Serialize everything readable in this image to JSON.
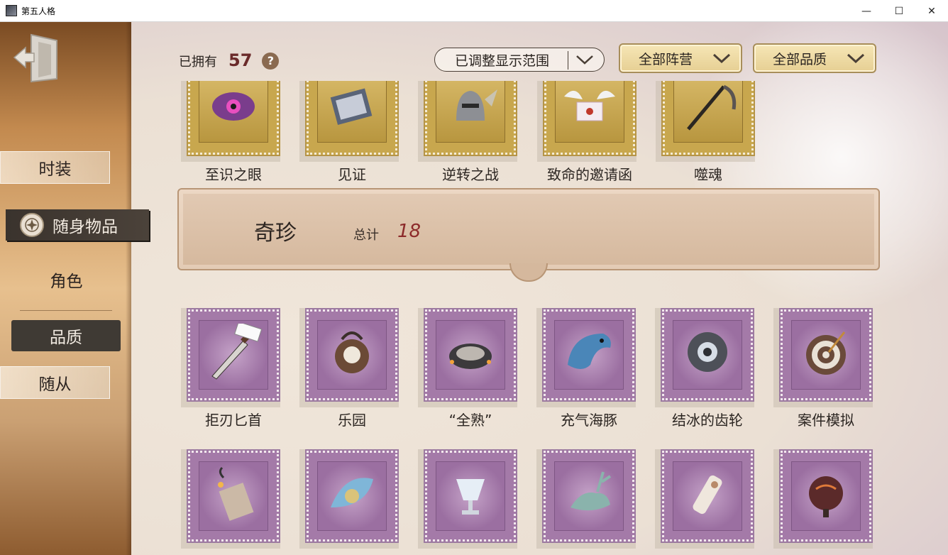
{
  "window": {
    "title": "第五人格",
    "controls": {
      "minimize": "—",
      "maximize": "☐",
      "close": "✕"
    }
  },
  "sidebar": {
    "back_icon": "exit-door-icon",
    "tabs": [
      {
        "label": "时装",
        "state": "inactive"
      },
      {
        "label": "随身物品",
        "state": "active"
      },
      {
        "label": "角色",
        "state": "subtab-inactive"
      },
      {
        "label": "品质",
        "state": "subtab-active"
      },
      {
        "label": "随从",
        "state": "inactive"
      }
    ]
  },
  "header": {
    "owned_label": "已拥有",
    "owned_count": "57",
    "help": "?",
    "range_filter": "已调整显示范围",
    "camp_filter": "全部阵营",
    "quality_filter": "全部品质"
  },
  "top_row": {
    "items": [
      {
        "name": "至识之眼"
      },
      {
        "name": "见证"
      },
      {
        "name": "逆转之战"
      },
      {
        "name": "致命的邀请函"
      },
      {
        "name": "噬魂"
      }
    ]
  },
  "section": {
    "title": "奇珍",
    "total_label": "总计",
    "total": "18"
  },
  "rare_row": {
    "items": [
      {
        "name": "拒刃匕首"
      },
      {
        "name": "乐园"
      },
      {
        "name": "“全熟”"
      },
      {
        "name": "充气海豚"
      },
      {
        "name": "结冰的齿轮"
      },
      {
        "name": "案件模拟"
      }
    ]
  },
  "colors": {
    "accent_red": "#8c2a2a",
    "gold_stamp": "#c8a74e",
    "purple_stamp": "#a47aa8"
  }
}
